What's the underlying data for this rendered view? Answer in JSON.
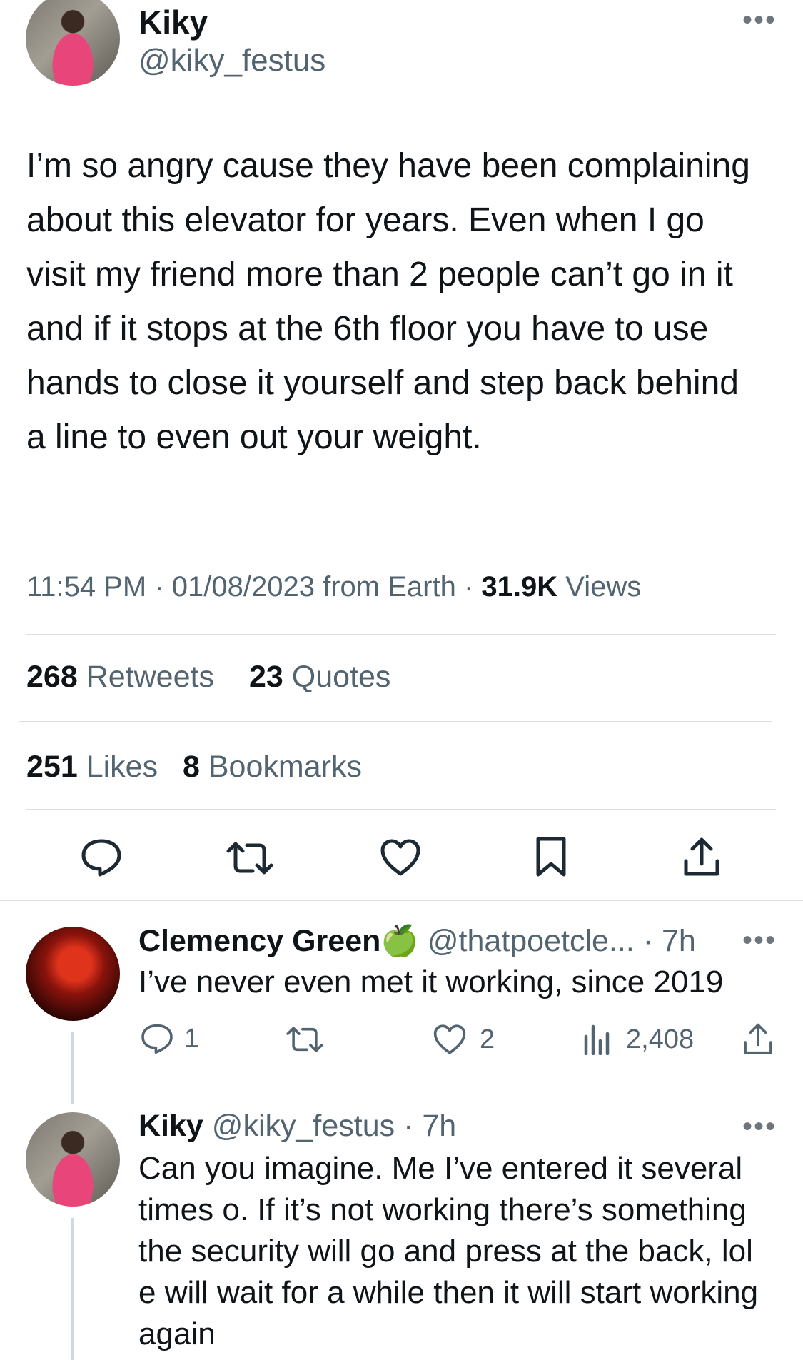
{
  "main_tweet": {
    "author_name": "Kiky",
    "author_handle": "@kiky_festus",
    "text": "I’m so angry cause they have been complaining about this elevator for years. Even when I go visit my friend more than 2 people can’t go in it and if it stops at the 6th floor you have to use hands to close it yourself and step back behind a line to even out your weight.",
    "time": "11:54 PM",
    "date": "01/08/2023",
    "source": "from Earth",
    "views_count": "31.9K",
    "views_label": "Views",
    "retweets_count": "268",
    "retweets_label": "Retweets",
    "quotes_count": "23",
    "quotes_label": "Quotes",
    "likes_count": "251",
    "likes_label": "Likes",
    "bookmarks_count": "8",
    "bookmarks_label": "Bookmarks"
  },
  "action_bar": [
    "reply-icon",
    "retweet-icon",
    "like-icon",
    "bookmark-icon",
    "share-icon"
  ],
  "replies": [
    {
      "author_name": "Clemency Green",
      "badge": "🍏",
      "author_handle": "@thatpoetcle...",
      "time": "· 7h",
      "text": "I’ve never even met it working, since 2019",
      "reply_count": "1",
      "like_count": "2",
      "views_count": "2,408"
    },
    {
      "author_name": "Kiky",
      "author_handle": "@kiky_festus",
      "time": "· 7h",
      "text": "Can you imagine. Me I’ve entered it several times o. If it’s not working there’s something the security will go and press at the back, lol e will wait for a while then it will start working again"
    }
  ],
  "colors": {
    "text": "#0f1419",
    "muted": "#536471",
    "divider": "#dcdfe2",
    "background": "#ffffff"
  }
}
